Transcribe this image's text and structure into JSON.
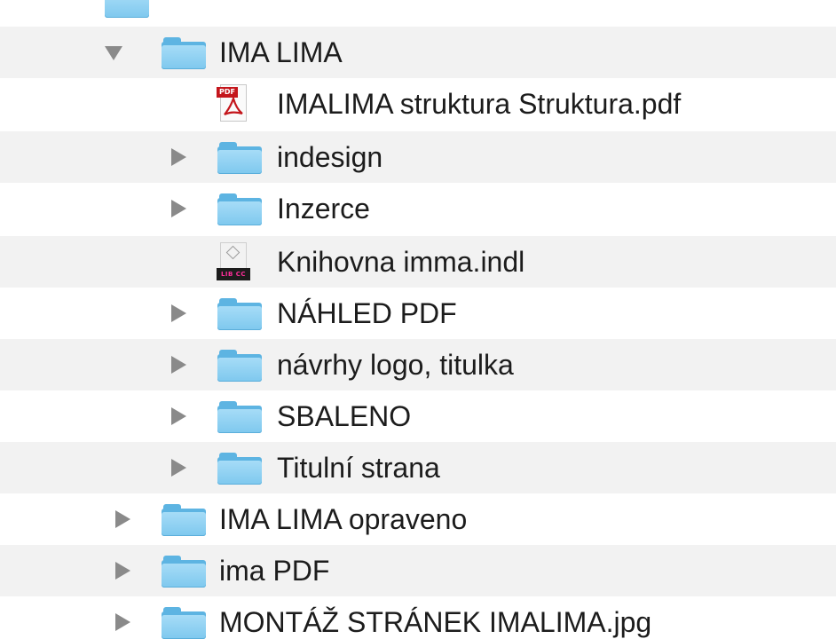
{
  "tree": {
    "rows": [
      {
        "name": "IMA LIMA",
        "kind": "folder",
        "icon": "folder-icon",
        "disclosure": "expanded"
      },
      {
        "name": "IMALIMA struktura Struktura.pdf",
        "kind": "pdf",
        "icon": "pdf-file-icon",
        "badge": "PDF"
      },
      {
        "name": "indesign",
        "kind": "folder",
        "icon": "folder-icon",
        "disclosure": "collapsed"
      },
      {
        "name": "Inzerce",
        "kind": "folder",
        "icon": "folder-icon",
        "disclosure": "collapsed"
      },
      {
        "name": "Knihovna imma.indl",
        "kind": "indesign-library",
        "icon": "indesign-library-icon",
        "badge": "LIB CC"
      },
      {
        "name": "NÁHLED PDF",
        "kind": "folder",
        "icon": "folder-icon",
        "disclosure": "collapsed"
      },
      {
        "name": "návrhy logo, titulka",
        "kind": "folder",
        "icon": "folder-icon",
        "disclosure": "collapsed"
      },
      {
        "name": "SBALENO",
        "kind": "folder",
        "icon": "folder-icon",
        "disclosure": "collapsed"
      },
      {
        "name": "Titulní strana",
        "kind": "folder",
        "icon": "folder-icon",
        "disclosure": "collapsed"
      },
      {
        "name": "IMA LIMA opraveno",
        "kind": "folder",
        "icon": "folder-icon",
        "disclosure": "collapsed"
      },
      {
        "name": "ima PDF",
        "kind": "folder",
        "icon": "folder-icon",
        "disclosure": "collapsed"
      },
      {
        "name": "MONTÁŽ STRÁNEK IMALIMA.jpg",
        "kind": "folder",
        "icon": "folder-icon",
        "disclosure": "collapsed"
      }
    ]
  },
  "colors": {
    "stripe": "#f2f2f2",
    "folder": "#7ec8ee",
    "disclosure": "#8a8a8a",
    "pdf_badge": "#c4161c",
    "lib_text": "#ff2d9a"
  }
}
